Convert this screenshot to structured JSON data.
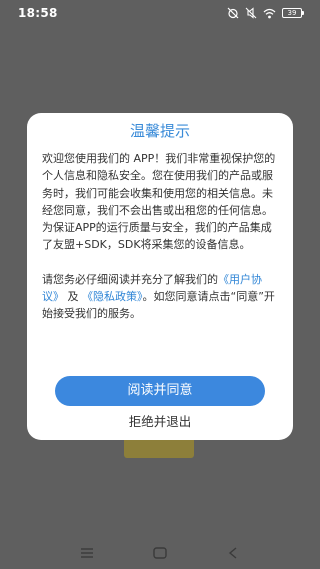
{
  "status_bar": {
    "time": "18:58",
    "battery_level": "39",
    "icons": [
      "alarm-off-icon",
      "mute-icon",
      "wifi-icon",
      "battery-icon"
    ]
  },
  "dialog": {
    "title": "温馨提示",
    "paragraph1": "欢迎您使用我们的 APP！我们非常重视保护您的个人信息和隐私安全。您在使用我们的产品或服务时，我们可能会收集和使用您的相关信息。未经您同意，我们不会出售或出租您的任何信息。为保证APP的运行质量与安全，我们的产品集成了友盟+SDK，SDK将采集您的设备信息。",
    "paragraph2_prefix": "请您务必仔细阅读并充分了解我们的",
    "user_agreement_link": "《用户协议》",
    "and_text": "及",
    "privacy_policy_link": "《隐私政策》",
    "paragraph2_suffix": "。如您同意请点击“同意”开始接受我们的服务。",
    "agree_label": "阅读并同意",
    "decline_label": "拒绝并退出"
  },
  "nav_bar": {
    "icons": [
      "menu-icon",
      "home-icon",
      "back-icon"
    ]
  },
  "colors": {
    "accent": "#3c88de",
    "link": "#2f85d6",
    "title": "#3a8bd8",
    "overlay": "#5f5f5f"
  }
}
